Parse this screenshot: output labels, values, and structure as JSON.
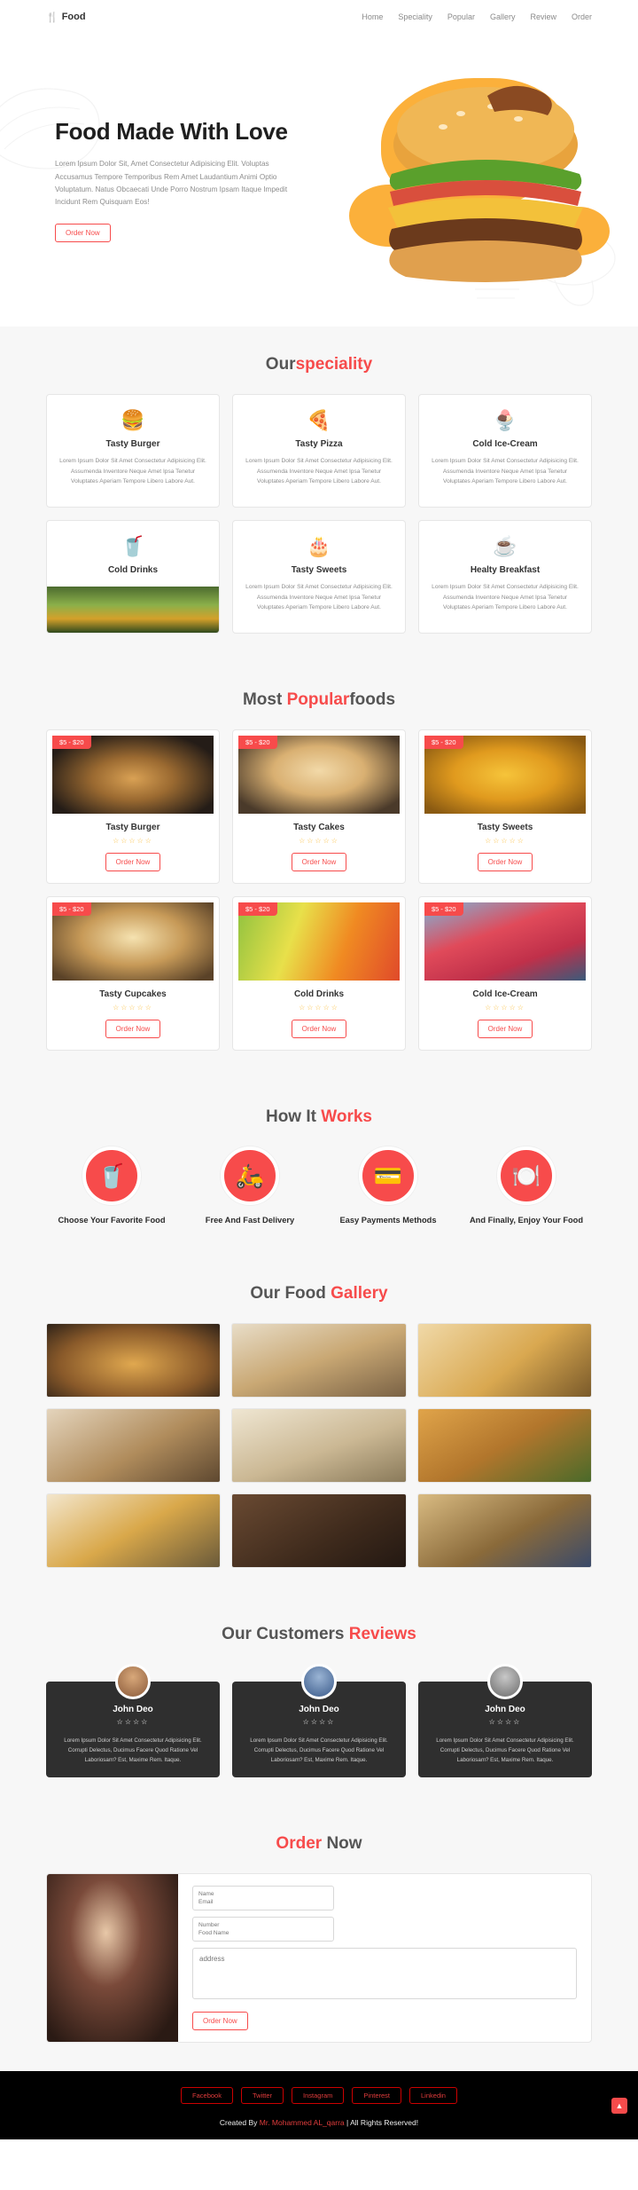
{
  "header": {
    "logo_text": "Food",
    "logo_icon": "cutlery-icon",
    "nav": [
      {
        "label": "Home"
      },
      {
        "label": "Speciality"
      },
      {
        "label": "Popular"
      },
      {
        "label": "Gallery"
      },
      {
        "label": "Review"
      },
      {
        "label": "Order"
      }
    ]
  },
  "hero": {
    "title": "Food Made With Love",
    "paragraph": "Lorem Ipsum Dolor Sit, Amet Consectetur Adipisicing Elit. Voluptas Accusamus Tempore Temporibus Rem Amet Laudantium Animi Optio Voluptatum. Natus Obcaecati Unde Porro Nostrum Ipsam Itaque Impedit Incidunt Rem Quisquam Eos!",
    "cta": "Order Now"
  },
  "speciality": {
    "heading_plain": "Our",
    "heading_accent": "speciality",
    "body": "Lorem Ipsum Dolor Sit Amet Consectetur Adipisicing Elit. Assumenda Inventore Neque Amet Ipsa Tenetur Voluptates Aperiam Tempore Libero Labore Aut.",
    "cards": [
      {
        "title": "Tasty Burger",
        "icon": "burger-icon"
      },
      {
        "title": "Tasty Pizza",
        "icon": "pizza-icon"
      },
      {
        "title": "Cold Ice-Cream",
        "icon": "ice-cream-icon"
      },
      {
        "title": "Cold Drinks",
        "icon": "drinks-icon"
      },
      {
        "title": "Tasty Sweets",
        "icon": "cake-icon"
      },
      {
        "title": "Healty Breakfast",
        "icon": "coffee-icon"
      }
    ]
  },
  "popular": {
    "heading_plain_1": "Most ",
    "heading_accent": "Popular",
    "heading_plain_2": "foods",
    "price": "$5 - $20",
    "stars": "☆☆☆☆☆",
    "cta": "Order Now",
    "cards": [
      {
        "title": "Tasty Burger"
      },
      {
        "title": "Tasty Cakes"
      },
      {
        "title": "Tasty Sweets"
      },
      {
        "title": "Tasty Cupcakes"
      },
      {
        "title": "Cold Drinks"
      },
      {
        "title": "Cold Ice-Cream"
      }
    ]
  },
  "steps": {
    "heading_plain": "How It ",
    "heading_accent": "Works",
    "items": [
      {
        "label": "Choose Your Favorite Food",
        "icon": "fast-food-icon"
      },
      {
        "label": "Free And Fast Delivery",
        "icon": "delivery-scooter-icon"
      },
      {
        "label": "Easy Payments Methods",
        "icon": "payment-icon"
      },
      {
        "label": "And Finally, Enjoy Your Food",
        "icon": "eating-person-icon"
      }
    ]
  },
  "gallery": {
    "heading_plain": "Our Food ",
    "heading_accent": "Gallery",
    "items": [
      {
        "alt": "burger-photo"
      },
      {
        "alt": "sandwich-photo"
      },
      {
        "alt": "pasta-photo"
      },
      {
        "alt": "cupcakes-photo"
      },
      {
        "alt": "dumplings-photo"
      },
      {
        "alt": "fried-chicken-photo"
      },
      {
        "alt": "breakfast-photo"
      },
      {
        "alt": "chocolates-photo"
      },
      {
        "alt": "granola-bars-photo"
      }
    ]
  },
  "reviews": {
    "heading_plain": "Our Customers ",
    "heading_accent": "Reviews",
    "cards": [
      {
        "name": "John Deo",
        "stars": "☆☆☆☆",
        "text": "Lorem Ipsum Dolor Sit Amet Consectetur Adipisicing Elit. Corrupti Delectus, Ducimus Facere Quod Ratione Vel Laboriosam? Est, Maxime Rem. Itaque."
      },
      {
        "name": "John Deo",
        "stars": "☆☆☆☆",
        "text": "Lorem Ipsum Dolor Sit Amet Consectetur Adipisicing Elit. Corrupti Delectus, Ducimus Facere Quod Ratione Vel Laboriosam? Est, Maxime Rem. Itaque."
      },
      {
        "name": "John Deo",
        "stars": "☆☆☆☆",
        "text": "Lorem Ipsum Dolor Sit Amet Consectetur Adipisicing Elit. Corrupti Delectus, Ducimus Facere Quod Ratione Vel Laboriosam? Est, Maxime Rem. Itaque."
      }
    ]
  },
  "order": {
    "heading_accent": "Order",
    "heading_plain": " Now",
    "fields": {
      "name": "Name",
      "email": "Email",
      "number": "Number",
      "food_name": "Food Name",
      "address": "address"
    },
    "cta": "Order Now"
  },
  "footer": {
    "socials": [
      {
        "label": "Facebook"
      },
      {
        "label": "Twitter"
      },
      {
        "label": "Instagram"
      },
      {
        "label": "Pinterest"
      },
      {
        "label": "Linkedin"
      }
    ],
    "credit_prefix": "Created By ",
    "credit_author": "Mr. Mohammed AL_qarra",
    "credit_suffix": " | All Rights Reserved!",
    "top_icon": "arrow-up-icon"
  },
  "colors": {
    "accent": "#f74b4b",
    "dark": "#2f2f2f",
    "bg": "#f7f7f7"
  }
}
